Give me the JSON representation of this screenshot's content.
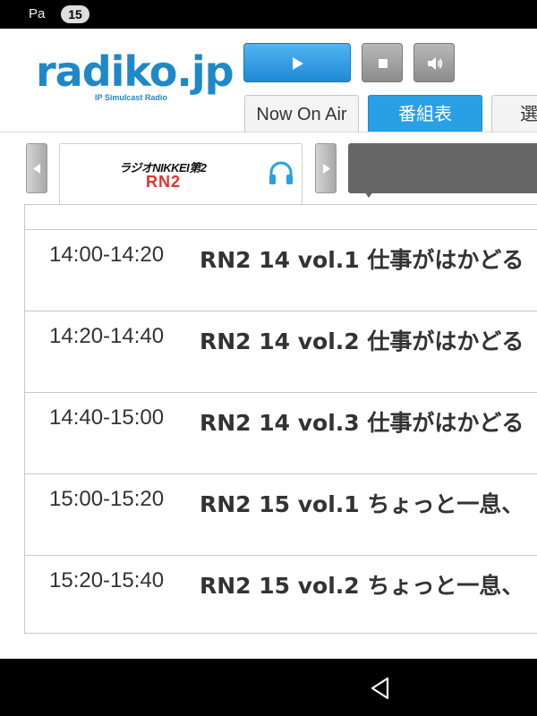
{
  "status_bar": {
    "app_label": "Pa",
    "notification_count": "15"
  },
  "header": {
    "logo": {
      "text": "radiko.jp",
      "subtitle": "IP Simulcast Radio"
    },
    "controls": {
      "play": "play-icon",
      "stop": "stop-icon",
      "volume": "volume-icon"
    },
    "tabs": [
      {
        "label": "Now On Air",
        "active": false
      },
      {
        "label": "番組表",
        "active": true
      },
      {
        "label": "選",
        "active": false
      }
    ],
    "accent_color": "#29a0e6"
  },
  "station": {
    "name": "ラジオNIKKEI第2",
    "logo_text": "RN2",
    "logo_color": "#e3312d",
    "listen_icon": "headphones-icon"
  },
  "programs": [
    {
      "time": "14:00-14:20",
      "title": "RN2 14 vol.1 仕事がはかどる"
    },
    {
      "time": "14:20-14:40",
      "title": "RN2 14 vol.2 仕事がはかどる"
    },
    {
      "time": "14:40-15:00",
      "title": "RN2 14 vol.3 仕事がはかどる"
    },
    {
      "time": "15:00-15:20",
      "title": "RN2 15 vol.1 ちょっと一息、"
    },
    {
      "time": "15:20-15:40",
      "title": "RN2 15 vol.2 ちょっと一息、"
    }
  ]
}
